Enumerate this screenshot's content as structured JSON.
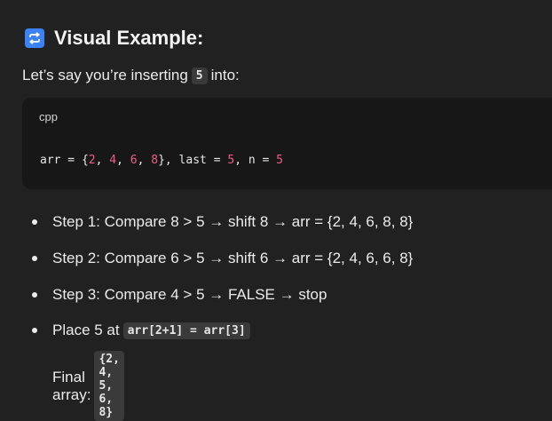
{
  "heading": {
    "icon": "repeat-arrows-icon",
    "title": "Visual Example:"
  },
  "intro": {
    "before": "Let’s say you’re inserting",
    "value": "5",
    "after": "into:"
  },
  "code_block": {
    "language": "cpp",
    "tokens": {
      "t1": "arr = {",
      "n1": "2",
      "c1": ", ",
      "n2": "4",
      "c2": ", ",
      "n3": "6",
      "c3": ", ",
      "n4": "8",
      "t2": "}, last = ",
      "n5": "5",
      "t3": ", n = ",
      "n6": "5"
    }
  },
  "steps": [
    {
      "text": "Step 1: Compare 8 > 5 → shift 8 → arr = {2, 4, 6, 8, 8}"
    },
    {
      "text": "Step 2: Compare 6 > 5 → shift 6 → arr = {2, 4, 6, 6, 8}"
    },
    {
      "text": "Step 3: Compare 4 > 5 → FALSE → stop"
    },
    {
      "text": "Place 5 at",
      "code": "arr[2+1] = arr[3]",
      "sub_text": "Final array:",
      "sub_code": "{2, 4, 5, 6, 8}"
    }
  ],
  "colors": {
    "background": "#212121",
    "code_bg": "#171717",
    "number": "#ee5d88",
    "icon_bg": "#3b82f6"
  }
}
